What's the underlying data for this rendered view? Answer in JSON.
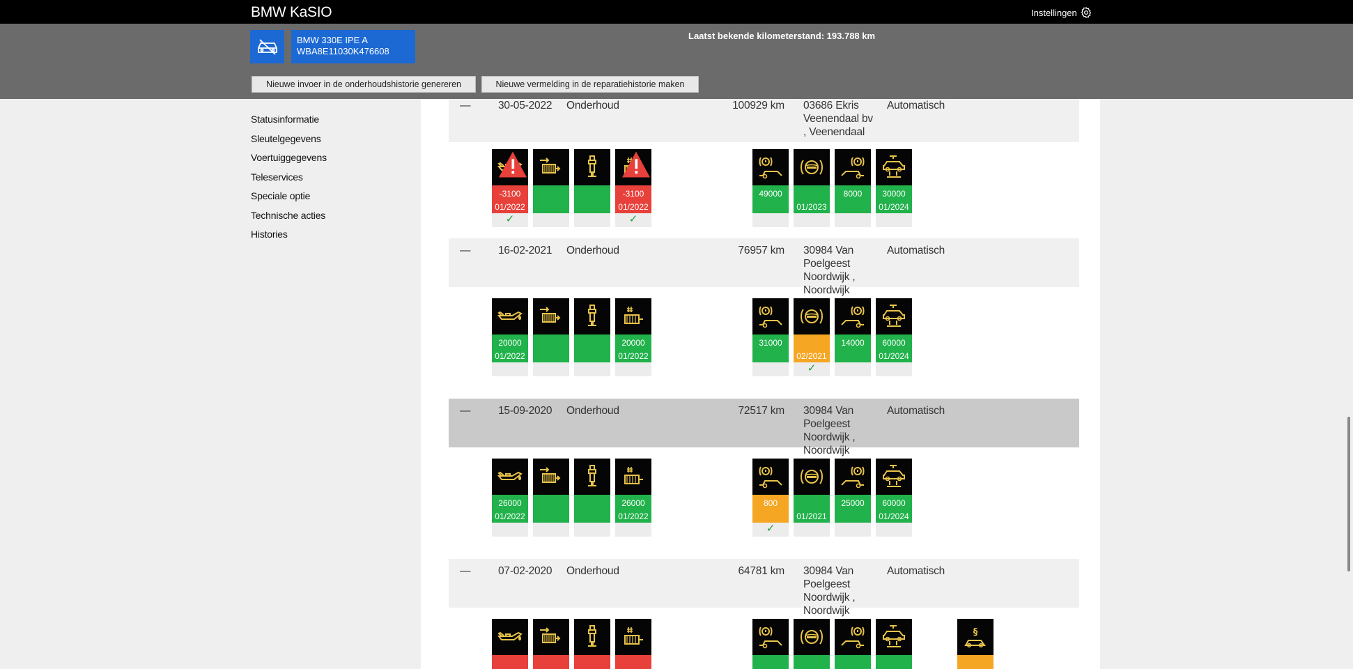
{
  "app": {
    "title": "BMW KaSIO",
    "settings_label": "Instellingen"
  },
  "vehicle": {
    "model": "BMW 330E IPE A",
    "vin": "WBA8E11030K476608",
    "mileage_text": "Laatst bekende kilometerstand: 193.788 km"
  },
  "actions": {
    "maintenance_entry": "Nieuwe invoer in de onderhoudshistorie genereren",
    "repair_entry": "Nieuwe vermelding in de reparatiehistorie maken"
  },
  "nav": [
    "Statusinformatie",
    "Sleutelgegevens",
    "Voertuiggegevens",
    "Teleservices",
    "Speciale optie",
    "Technische acties",
    "Histories"
  ],
  "colors": {
    "topbar": "#000000",
    "header": "#6b6b6b",
    "accent_blue": "#1c69d4",
    "ok_green": "#21b24b",
    "overdue_red": "#e8403a",
    "due_orange": "#f5a623",
    "icon_yellow": "#e8c34a",
    "check_green": "#1f9d39"
  },
  "entries": [
    {
      "toggle": "—",
      "date": "30-05-2022",
      "type": "Onderhoud",
      "km": "100929 km",
      "dealer_lines": [
        "03686 Ekris",
        "Veenendaal bv",
        ", Veenendaal"
      ],
      "mode": "Automatisch",
      "highlighted": false,
      "tiles": [
        {
          "icon": "oil-can-icon",
          "color": "red",
          "value": "-3100",
          "date": "01/2022",
          "check": true,
          "warning": true
        },
        {
          "icon": "microfilter-icon",
          "color": "green",
          "value": "",
          "date": "",
          "check": false,
          "warning": false
        },
        {
          "icon": "spark-plug-icon",
          "color": "green",
          "value": "",
          "date": "",
          "check": false,
          "warning": false
        },
        {
          "icon": "air-filter-icon",
          "color": "red",
          "value": "-3100",
          "date": "01/2022",
          "check": true,
          "warning": true
        },
        {
          "icon": "front-brakes-icon",
          "color": "green",
          "value": "49000",
          "date": "",
          "check": false,
          "warning": false
        },
        {
          "icon": "brake-fluid-icon",
          "color": "green",
          "value": "",
          "date": "01/2023",
          "check": false,
          "warning": false
        },
        {
          "icon": "rear-brakes-icon",
          "color": "green",
          "value": "8000",
          "date": "",
          "check": false,
          "warning": false
        },
        {
          "icon": "vehicle-check-icon",
          "color": "green",
          "value": "30000",
          "date": "01/2024",
          "check": false,
          "warning": false
        }
      ]
    },
    {
      "toggle": "—",
      "date": "16-02-2021",
      "type": "Onderhoud",
      "km": "76957 km",
      "dealer_lines": [
        "30984 Van",
        "Poelgeest",
        "Noordwijk ,",
        "Noordwijk"
      ],
      "mode": "Automatisch",
      "highlighted": false,
      "tiles": [
        {
          "icon": "oil-can-icon",
          "color": "green",
          "value": "20000",
          "date": "01/2022",
          "check": false,
          "warning": false
        },
        {
          "icon": "microfilter-icon",
          "color": "green",
          "value": "",
          "date": "",
          "check": false,
          "warning": false
        },
        {
          "icon": "spark-plug-icon",
          "color": "green",
          "value": "",
          "date": "",
          "check": false,
          "warning": false
        },
        {
          "icon": "air-filter-icon",
          "color": "green",
          "value": "20000",
          "date": "01/2022",
          "check": false,
          "warning": false
        },
        {
          "icon": "front-brakes-icon",
          "color": "green",
          "value": "31000",
          "date": "",
          "check": false,
          "warning": false
        },
        {
          "icon": "brake-fluid-icon",
          "color": "orange",
          "value": "",
          "date": "02/2021",
          "check": true,
          "warning": false
        },
        {
          "icon": "rear-brakes-icon",
          "color": "green",
          "value": "14000",
          "date": "",
          "check": false,
          "warning": false
        },
        {
          "icon": "vehicle-check-icon",
          "color": "green",
          "value": "60000",
          "date": "01/2024",
          "check": false,
          "warning": false
        }
      ]
    },
    {
      "toggle": "—",
      "date": "15-09-2020",
      "type": "Onderhoud",
      "km": "72517 km",
      "dealer_lines": [
        "30984 Van",
        "Poelgeest",
        "Noordwijk ,",
        "Noordwijk"
      ],
      "mode": "Automatisch",
      "highlighted": true,
      "tiles": [
        {
          "icon": "oil-can-icon",
          "color": "green",
          "value": "26000",
          "date": "01/2022",
          "check": false,
          "warning": false
        },
        {
          "icon": "microfilter-icon",
          "color": "green",
          "value": "",
          "date": "",
          "check": false,
          "warning": false
        },
        {
          "icon": "spark-plug-icon",
          "color": "green",
          "value": "",
          "date": "",
          "check": false,
          "warning": false
        },
        {
          "icon": "air-filter-icon",
          "color": "green",
          "value": "26000",
          "date": "01/2022",
          "check": false,
          "warning": false
        },
        {
          "icon": "front-brakes-icon",
          "color": "orange",
          "value": "800",
          "date": "",
          "check": true,
          "warning": false
        },
        {
          "icon": "brake-fluid-icon",
          "color": "green",
          "value": "",
          "date": "01/2021",
          "check": false,
          "warning": false
        },
        {
          "icon": "rear-brakes-icon",
          "color": "green",
          "value": "25000",
          "date": "",
          "check": false,
          "warning": false
        },
        {
          "icon": "vehicle-check-icon",
          "color": "green",
          "value": "60000",
          "date": "01/2024",
          "check": false,
          "warning": false
        }
      ]
    },
    {
      "toggle": "—",
      "date": "07-02-2020",
      "type": "Onderhoud",
      "km": "64781 km",
      "dealer_lines": [
        "30984 Van",
        "Poelgeest",
        "Noordwijk ,",
        "Noordwijk"
      ],
      "mode": "Automatisch",
      "highlighted": false,
      "tiles": [
        {
          "icon": "oil-can-icon",
          "color": "red",
          "value": "",
          "date": "",
          "check": false,
          "warning": false
        },
        {
          "icon": "microfilter-icon",
          "color": "red",
          "value": "",
          "date": "",
          "check": false,
          "warning": false
        },
        {
          "icon": "spark-plug-icon",
          "color": "red",
          "value": "",
          "date": "",
          "check": false,
          "warning": false
        },
        {
          "icon": "air-filter-icon",
          "color": "red",
          "value": "",
          "date": "",
          "check": false,
          "warning": false
        },
        {
          "icon": "front-brakes-icon",
          "color": "green",
          "value": "",
          "date": "",
          "check": false,
          "warning": false
        },
        {
          "icon": "brake-fluid-icon",
          "color": "green",
          "value": "",
          "date": "",
          "check": false,
          "warning": false
        },
        {
          "icon": "rear-brakes-icon",
          "color": "green",
          "value": "",
          "date": "",
          "check": false,
          "warning": false
        },
        {
          "icon": "vehicle-check-icon",
          "color": "green",
          "value": "",
          "date": "",
          "check": false,
          "warning": false
        },
        {
          "icon": "legal-inspection-icon",
          "color": "orange",
          "value": "",
          "date": "",
          "check": false,
          "warning": false
        }
      ]
    }
  ]
}
